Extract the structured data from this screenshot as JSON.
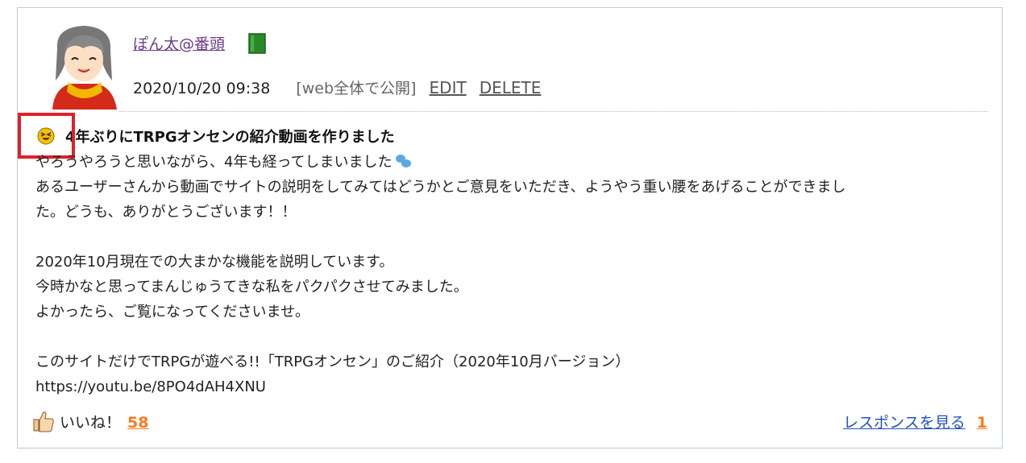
{
  "post": {
    "username": "ぽん太@番頭",
    "datetime": "2020/10/20 09:38",
    "scope": "[web全体で公開]",
    "edit_label": "EDIT",
    "delete_label": "DELETE",
    "title": "4年ぶりにTRPGオンセンの紹介動画を作りました",
    "body_lines": [
      "やろうやろうと思いながら、4年も経ってしまいました",
      "あるユーザーさんから動画でサイトの説明をしてみてはどうかとご意見をいただき、ようやう重い腰をあげることができまし",
      "た。どうも、ありがとうございます！！",
      "",
      "2020年10月現在での大まかな機能を説明しています。",
      "今時かなと思ってまんじゅうてきな私をパクパクさせてみました。",
      "よかったら、ご覧になってくださいませ。",
      "",
      "このサイトだけでTRPGが遊べる!!「TRPGオンセン」のご紹介（2020年10月バージョン）",
      "https://youtu.be/8PO4dAH4XNU"
    ],
    "like_label": "いいね！",
    "like_count": "58",
    "response_label": "レスポンスを見る",
    "response_count": "1"
  },
  "icons": {
    "avatar": "avatar-girl",
    "book": "book-icon",
    "title_emoji": "grinning-squint-face-icon",
    "drops": "sweat-drops-icon",
    "like": "thumbs-up-icon"
  },
  "colors": {
    "username": "#6b3a8c",
    "count": "#ff7a1a",
    "link": "#2255bb",
    "highlight": "#e0202a",
    "card_border": "#b9cdd6"
  }
}
